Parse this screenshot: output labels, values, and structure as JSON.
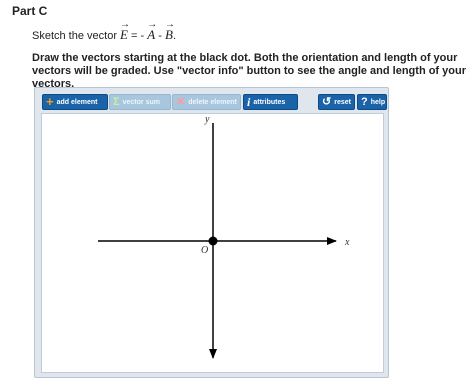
{
  "part": {
    "title": "Part C"
  },
  "question": {
    "prefix": "Sketch the vector ",
    "E": "E",
    "eq_minus": " = - ",
    "A": "A",
    "minus": " - ",
    "B": "B",
    "suffix": "."
  },
  "instructions": "Draw the vectors starting at the black dot. Both the orientation and length of your vectors will be graded. Use \"vector info\" button to see the angle and length of your vectors.",
  "toolbar": {
    "add_element": {
      "label": "add element",
      "icon": "plus-icon",
      "enabled": true
    },
    "vector_sum": {
      "label": "vector sum",
      "icon": "sigma-icon",
      "enabled": false
    },
    "delete_element": {
      "label": "delete element",
      "icon": "x-icon",
      "enabled": false
    },
    "attributes": {
      "label": "attributes",
      "icon": "info-icon",
      "enabled": true
    },
    "reset": {
      "label": "reset",
      "icon": "reset-icon",
      "enabled": true
    },
    "help": {
      "label": "help",
      "icon": "question-icon",
      "enabled": true
    }
  },
  "canvas": {
    "y_axis_label": "y",
    "x_axis_label": "x",
    "origin_label": "O"
  },
  "colors": {
    "button_active": "#1a63a8",
    "button_disabled": "#a9c6df",
    "frame_bg": "#dfe6ee",
    "axis": "#000000"
  }
}
